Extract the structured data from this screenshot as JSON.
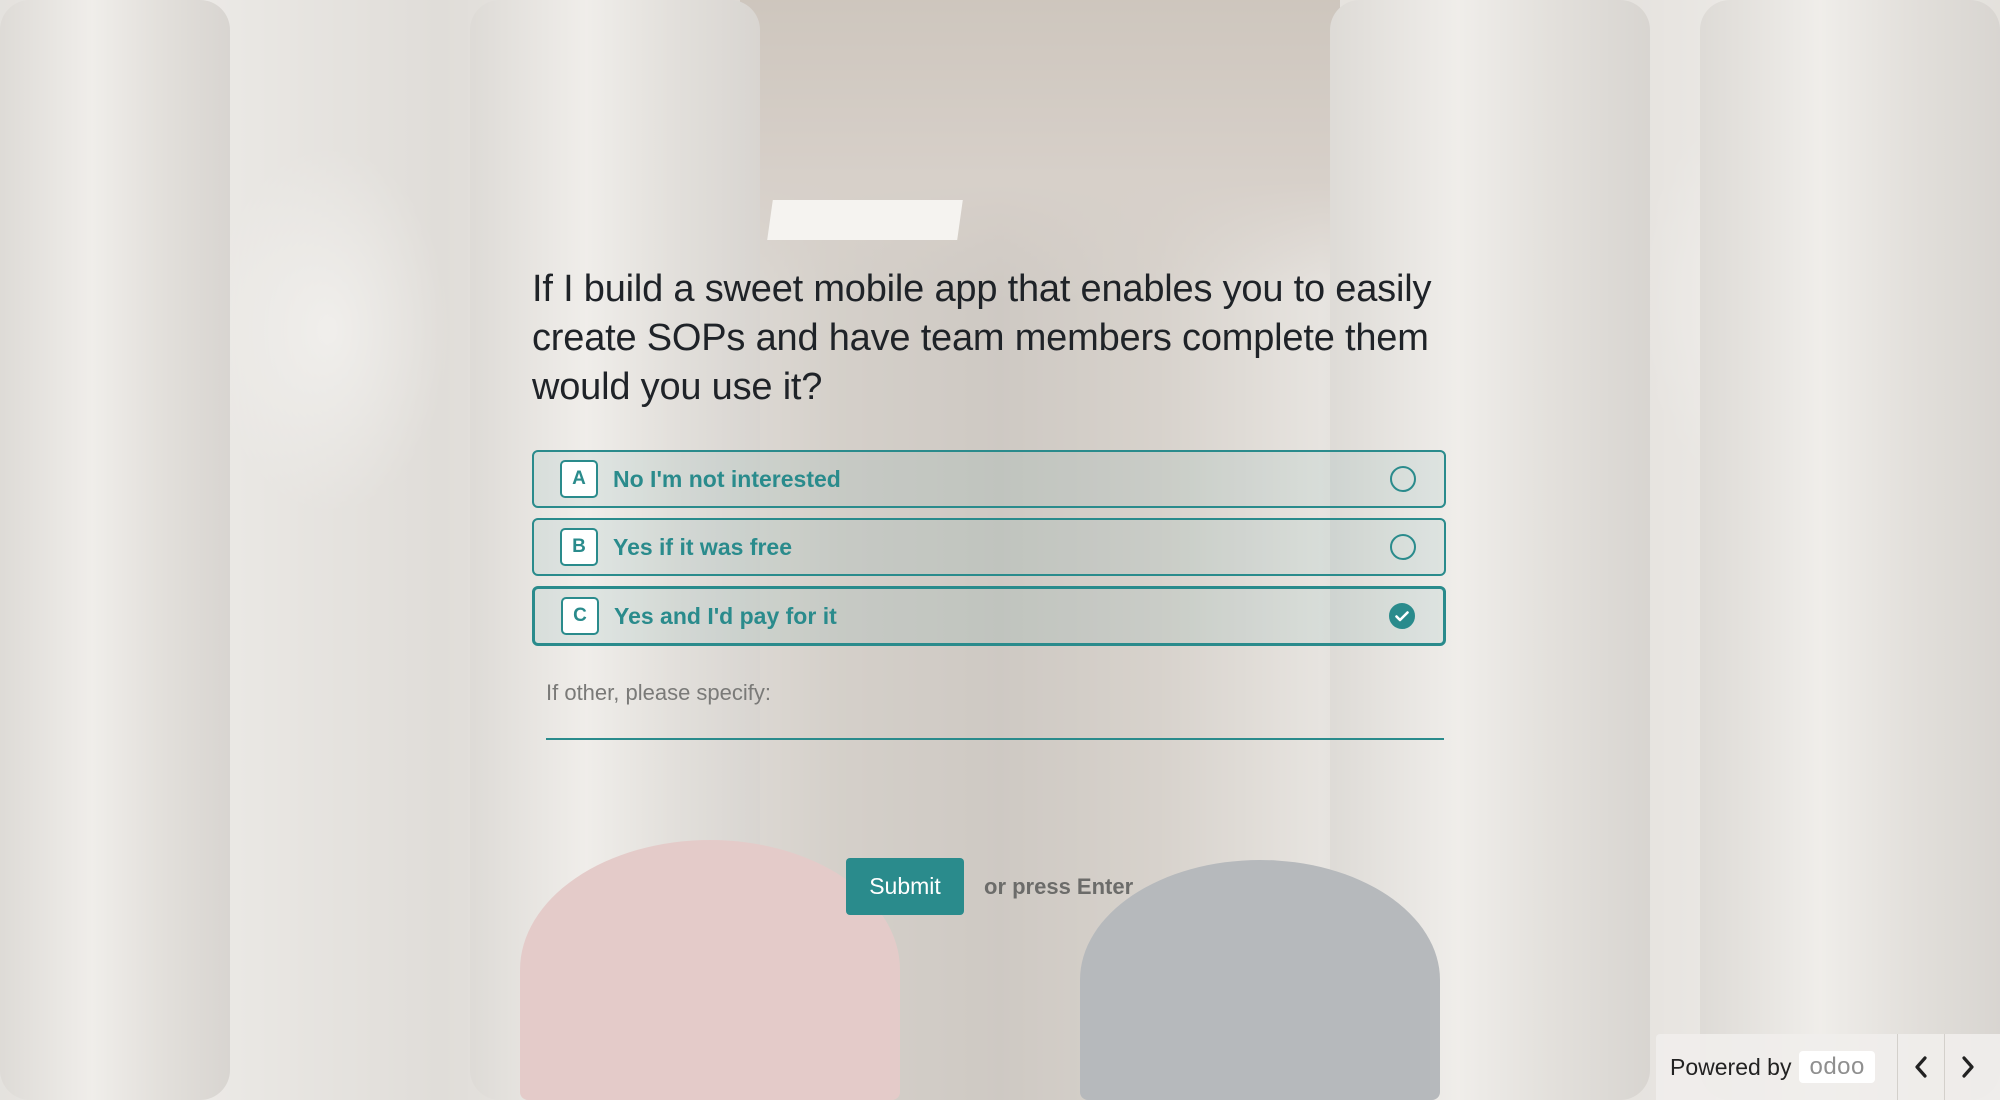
{
  "question": "If I build a sweet mobile app that enables you to easily create SOPs and have team members complete them would you use it?",
  "options": [
    {
      "key": "A",
      "label": "No I'm not interested",
      "selected": false
    },
    {
      "key": "B",
      "label": "Yes if it was free",
      "selected": false
    },
    {
      "key": "C",
      "label": "Yes and I'd pay for it",
      "selected": true
    }
  ],
  "other": {
    "placeholder": "If other, please specify:",
    "value": ""
  },
  "submit": {
    "label": "Submit",
    "hint": "or press Enter"
  },
  "footer": {
    "powered_by": "Powered by",
    "logo_text": "odoo",
    "prev_icon": "chevron-left-icon",
    "next_icon": "chevron-right-icon"
  },
  "colors": {
    "accent": "#2a8b8c",
    "text": "#1f2328",
    "muted": "#6c6c6a"
  }
}
